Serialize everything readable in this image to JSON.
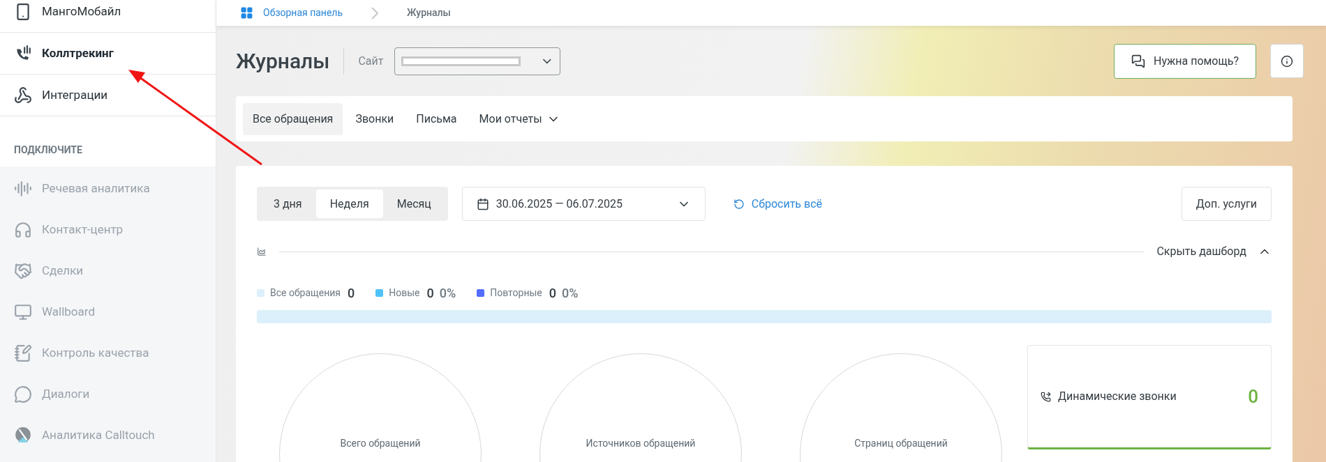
{
  "sidebar": {
    "items": [
      {
        "label": "МангоМобайл",
        "selected": false
      },
      {
        "label": "Коллтрекинг",
        "selected": true
      },
      {
        "label": "Интеграции",
        "selected": false
      }
    ],
    "section": {
      "title": "ПОДКЛЮЧИТЕ",
      "items": [
        {
          "label": "Речевая аналитика"
        },
        {
          "label": "Контакт-центр"
        },
        {
          "label": "Сделки"
        },
        {
          "label": "Wallboard"
        },
        {
          "label": "Контроль качества"
        },
        {
          "label": "Диалоги"
        },
        {
          "label": "Аналитика Calltouch"
        }
      ]
    }
  },
  "breadcrumb": [
    {
      "label": "Обзорная панель",
      "kind": "link"
    },
    {
      "label": "Журналы",
      "kind": "current"
    }
  ],
  "header": {
    "title": "Журналы",
    "site_label": "Сайт",
    "help_button": "Нужна помощь?"
  },
  "tabs": [
    {
      "label": "Все обращения",
      "selected": true,
      "kind": "tab"
    },
    {
      "label": "Звонки",
      "selected": false,
      "kind": "tab"
    },
    {
      "label": "Письма",
      "selected": false,
      "kind": "tab"
    },
    {
      "label": "Мои отчеты",
      "selected": false,
      "kind": "dropdown"
    }
  ],
  "filters": {
    "periods": [
      {
        "label": "3 дня",
        "selected": false
      },
      {
        "label": "Неделя",
        "selected": true
      },
      {
        "label": "Месяц",
        "selected": false
      }
    ],
    "date_range": "30.06.2025 — 06.07.2025",
    "reset": "Сбросить всё",
    "extra_button": "Доп. услуги"
  },
  "dashboard": {
    "toggle": "Скрыть дашборд",
    "expanded": true,
    "legend": [
      {
        "label": "Все обращения",
        "count": "0",
        "color": "#dcf0fb"
      },
      {
        "label": "Новые",
        "count": "0",
        "percent": "0%",
        "color": "#4fc3f7"
      },
      {
        "label": "Повторные",
        "count": "0",
        "percent": "0%",
        "color": "#536dfe"
      }
    ],
    "circles": [
      {
        "label": "Всего обращений"
      },
      {
        "label": "Источников обращений"
      },
      {
        "label": "Страниц обращений"
      }
    ],
    "side_card": {
      "label": "Динамические звонки",
      "value": "0"
    }
  }
}
